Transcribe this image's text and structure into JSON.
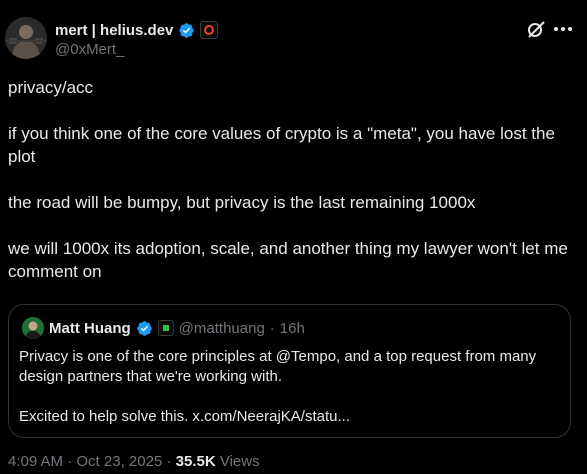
{
  "author": {
    "display_name": "mert | helius.dev",
    "handle": "@0xMert_",
    "verified_color": "#1d9bf0"
  },
  "post": {
    "paragraphs": [
      "privacy/acc",
      "if you think one of the core values of crypto is a \"meta\", you have lost the plot",
      "the road will be bumpy, but privacy is the last remaining 1000x",
      "we will 1000x its adoption, scale, and another thing my lawyer won't let me comment on"
    ]
  },
  "quote": {
    "display_name": "Matt Huang",
    "handle": "@matthuang",
    "separator": "·",
    "time": "16h",
    "paragraphs": [
      "Privacy is one of the core principles at @Tempo, and a top request from many design partners that we're working with.",
      "Excited to help solve this. x.com/NeerajKA/statu..."
    ]
  },
  "meta": {
    "time": "4:09 AM",
    "date": "Oct 23, 2025",
    "separator": "·",
    "views_count": "35.5K",
    "views_label": "Views"
  },
  "icons": {
    "grok": "grok-icon",
    "more": "more-options-icon",
    "verified": "verified-badge-icon"
  }
}
